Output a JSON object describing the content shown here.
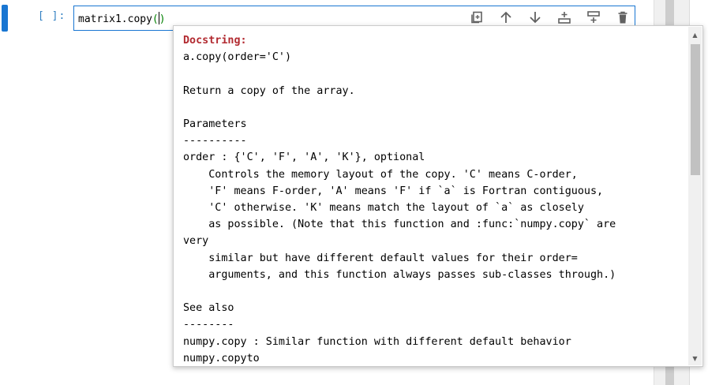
{
  "cell": {
    "prompt": "[ ]:",
    "code_text": "matrix1.copy",
    "code_parens": "()"
  },
  "toolbar": {
    "icons": [
      "duplicate-icon",
      "move-up-icon",
      "move-down-icon",
      "insert-above-icon",
      "insert-below-icon",
      "delete-icon"
    ]
  },
  "tooltip": {
    "heading": "Docstring:",
    "lines": [
      "a.copy(order='C')",
      "",
      "Return a copy of the array.",
      "",
      "Parameters",
      "----------",
      "order : {'C', 'F', 'A', 'K'}, optional",
      "    Controls the memory layout of the copy. 'C' means C-order,",
      "    'F' means F-order, 'A' means 'F' if `a` is Fortran contiguous,",
      "    'C' otherwise. 'K' means match the layout of `a` as closely",
      "    as possible. (Note that this function and :func:`numpy.copy` are",
      "very",
      "    similar but have different default values for their order=",
      "    arguments, and this function always passes sub-classes through.)",
      "",
      "See also",
      "--------",
      "numpy.copy : Similar function with different default behavior",
      "numpy.copyto"
    ]
  },
  "colors": {
    "accent": "#1976d2",
    "prompt": "#307fc1",
    "heading": "#b22b31",
    "paren": "#008000"
  }
}
